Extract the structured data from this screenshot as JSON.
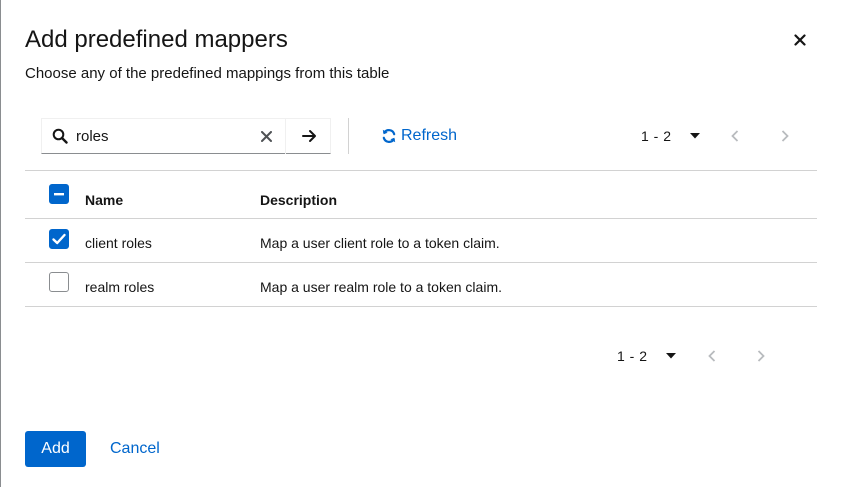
{
  "modal": {
    "title": "Add predefined mappers",
    "subtitle": "Choose any of the predefined mappings from this table"
  },
  "toolbar": {
    "search_value": "roles",
    "refresh_label": "Refresh"
  },
  "pagination_top": {
    "range": "1 - 2"
  },
  "pagination_bottom": {
    "range": "1 - 2"
  },
  "table": {
    "columns": [
      "Name",
      "Description"
    ],
    "header_checkbox_state": "partial",
    "rows": [
      {
        "name": "client roles",
        "description": "Map a user client role to a token claim.",
        "checked": true
      },
      {
        "name": "realm roles",
        "description": "Map a user realm role to a token claim.",
        "checked": false
      }
    ]
  },
  "footer": {
    "add_label": "Add",
    "cancel_label": "Cancel"
  },
  "colors": {
    "primary": "#0066cc",
    "text": "#151515",
    "border": "#d2d2d2",
    "disabled": "#b8bbbe"
  },
  "icons": [
    "close-icon",
    "search-icon",
    "clear-icon",
    "arrow-right-icon",
    "sync-icon",
    "caret-down-icon",
    "angle-left-icon",
    "angle-right-icon",
    "minus-icon",
    "check-icon"
  ]
}
